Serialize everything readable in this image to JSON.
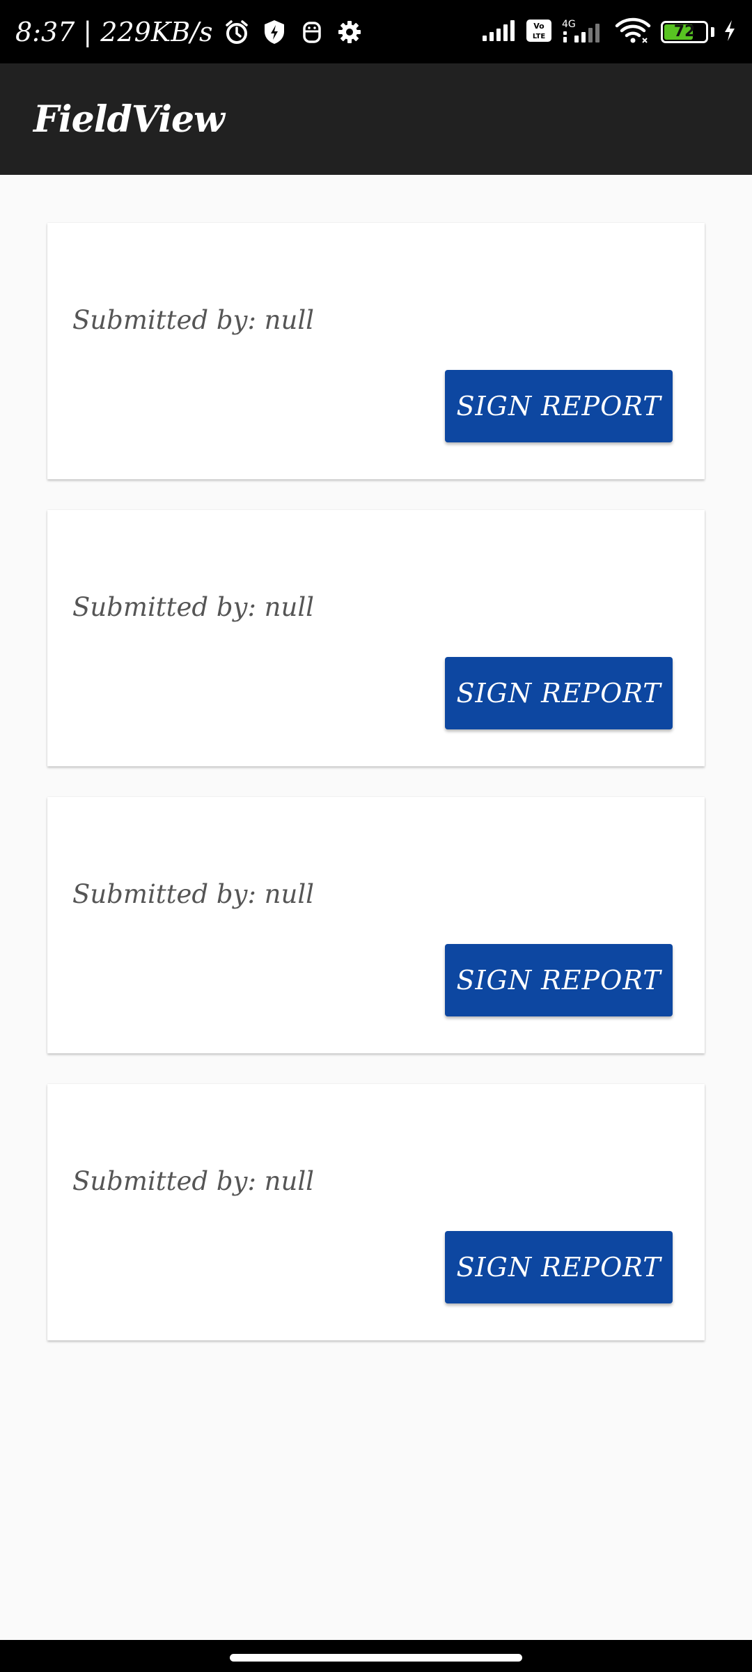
{
  "status_bar": {
    "time_speed": "8:37 | 229KB/s",
    "icons_left": [
      "alarm-icon",
      "shield-icon",
      "robot-icon",
      "gear-icon"
    ],
    "icons_right": [
      "signal-icon",
      "volte-icon",
      "4g-signal-icon",
      "wifi-icon",
      "battery-icon",
      "charging-icon"
    ],
    "volte_label": "Vo LTE",
    "network_label": "4G",
    "battery_level": "72",
    "battery_color": "#58c322"
  },
  "app_bar": {
    "title": "FieldView"
  },
  "reports": [
    {
      "submitted_by": "Submitted by: null",
      "button_label": "SIGN REPORT"
    },
    {
      "submitted_by": "Submitted by: null",
      "button_label": "SIGN REPORT"
    },
    {
      "submitted_by": "Submitted by: null",
      "button_label": "SIGN REPORT"
    },
    {
      "submitted_by": "Submitted by: null",
      "button_label": "SIGN REPORT"
    }
  ],
  "colors": {
    "app_bar": "#212121",
    "button": "#0d47a1",
    "background": "#fafafa"
  }
}
